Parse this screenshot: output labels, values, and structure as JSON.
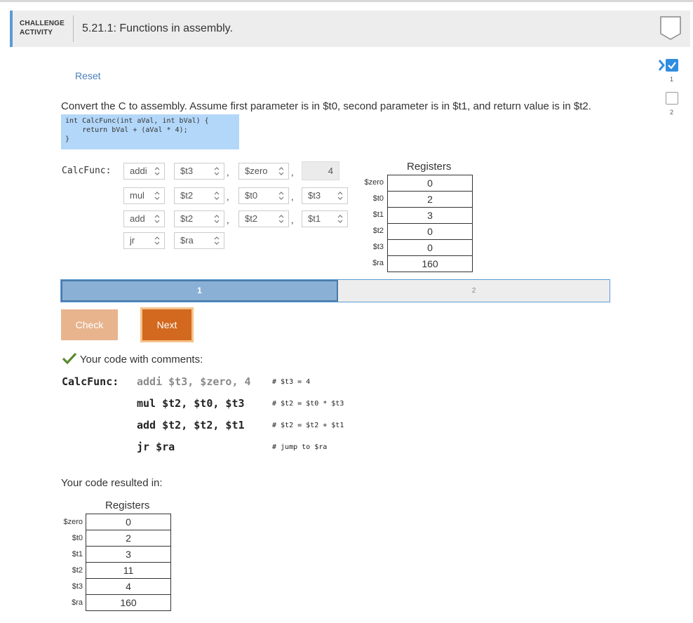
{
  "header": {
    "kind_line1": "CHALLENGE",
    "kind_line2": "ACTIVITY",
    "title": "5.21.1: Functions in assembly."
  },
  "progress": {
    "levels": [
      {
        "number": "1",
        "status": "completed"
      },
      {
        "number": "2",
        "status": "incomplete"
      }
    ]
  },
  "reset_label": "Reset",
  "instructions": "Convert the C to assembly. Assume first parameter is in $t0, second parameter is in $t1, and return value is in $t2.",
  "c_code": "int CalcFunc(int aVal, int bVal) {\n    return bVal + (aVal * 4);\n}",
  "editor": {
    "func_label": "CalcFunc:",
    "rows": [
      {
        "op": "addi",
        "a": "$t3",
        "b": "$zero",
        "imm": "4"
      },
      {
        "op": "mul",
        "a": "$t2",
        "b": "$t0",
        "c": "$t3"
      },
      {
        "op": "add",
        "a": "$t2",
        "b": "$t2",
        "c": "$t1"
      },
      {
        "op": "jr",
        "a": "$ra"
      }
    ]
  },
  "registers_expected": {
    "title": "Registers",
    "rows": [
      {
        "name": "$zero",
        "value": "0"
      },
      {
        "name": "$t0",
        "value": "2"
      },
      {
        "name": "$t1",
        "value": "3"
      },
      {
        "name": "$t2",
        "value": "0"
      },
      {
        "name": "$t3",
        "value": "0"
      },
      {
        "name": "$ra",
        "value": "160"
      }
    ]
  },
  "steps": {
    "step1": "1",
    "step2": "2"
  },
  "buttons": {
    "check": "Check",
    "next": "Next"
  },
  "feedback": {
    "heading": "Your code with comments:",
    "label": "CalcFunc:",
    "lines": [
      {
        "code": "addi $t3, $zero, 4",
        "comment": "# $t3 = 4"
      },
      {
        "code": "mul $t2, $t0, $t3",
        "comment": "# $t2 = $t0 * $t3"
      },
      {
        "code": "add $t2, $t2, $t1",
        "comment": "# $t2 = $t2 + $t1"
      },
      {
        "code": "jr $ra",
        "comment": "# jump to $ra"
      }
    ]
  },
  "resulted_label": "Your code resulted in:",
  "registers_result": {
    "title": "Registers",
    "rows": [
      {
        "name": "$zero",
        "value": "0"
      },
      {
        "name": "$t0",
        "value": "2"
      },
      {
        "name": "$t1",
        "value": "3"
      },
      {
        "name": "$t2",
        "value": "11"
      },
      {
        "name": "$t3",
        "value": "4"
      },
      {
        "name": "$ra",
        "value": "160"
      }
    ]
  },
  "colors": {
    "accent": "#5b9bd5",
    "next": "#d2691e",
    "check": "#e8b48e",
    "success": "#5a8a2e"
  }
}
